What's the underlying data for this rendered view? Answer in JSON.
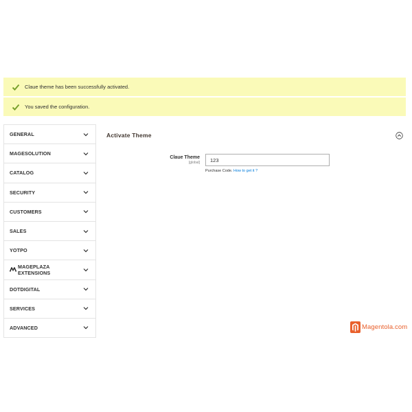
{
  "messages": [
    {
      "text": "Claue theme has been successfully activated.",
      "icon": "check-icon",
      "type": "success"
    },
    {
      "text": "You saved the configuration.",
      "icon": "check-icon",
      "type": "success"
    }
  ],
  "sidebar": {
    "items": [
      {
        "label": "GENERAL"
      },
      {
        "label": "MAGESOLUTION"
      },
      {
        "label": "CATALOG"
      },
      {
        "label": "SECURITY"
      },
      {
        "label": "CUSTOMERS"
      },
      {
        "label": "SALES"
      },
      {
        "label": "YOTPO"
      },
      {
        "label": "MAGEPLAZA EXTENSIONS",
        "icon": "mageplaza-icon"
      },
      {
        "label": "DOTDIGITAL"
      },
      {
        "label": "SERVICES"
      },
      {
        "label": "ADVANCED"
      }
    ]
  },
  "section": {
    "title": "Activate Theme",
    "collapse_icon": "chevron-up-circle-icon",
    "field": {
      "label": "Claue Theme",
      "scope": "[global]",
      "value": "123",
      "note": "Purchase Code.",
      "link": "How to get it ?"
    }
  },
  "brand": {
    "name": "Magentola.com",
    "icon": "magento-logo-icon"
  },
  "colors": {
    "message_bg": "#fafab8",
    "check": "#79a22e",
    "link": "#007bdb",
    "brand": "#e9602c",
    "border": "#e3e3e3"
  }
}
